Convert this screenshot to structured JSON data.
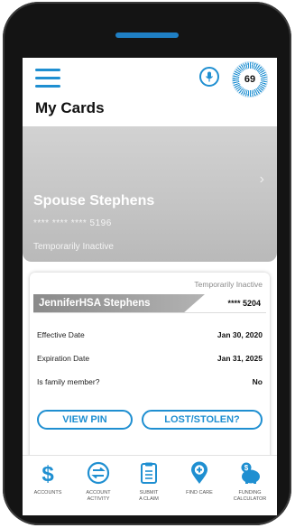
{
  "header": {
    "score": "69",
    "title": "My Cards"
  },
  "inactive_card": {
    "name": "Spouse Stephens",
    "number": "**** **** **** 5196",
    "status": "Temporarily Inactive"
  },
  "active_card": {
    "status": "Temporarily Inactive",
    "name": "JenniferHSA Stephens",
    "number": "**** 5204",
    "rows": [
      {
        "label": "Effective Date",
        "value": "Jan 30, 2020"
      },
      {
        "label": "Expiration Date",
        "value": "Jan 31, 2025"
      },
      {
        "label": "Is family member?",
        "value": "No"
      }
    ],
    "view_pin_label": "VIEW PIN",
    "lost_stolen_label": "LOST/STOLEN?"
  },
  "bottom_nav": [
    {
      "label": "ACCOUNTS",
      "icon": "dollar-icon"
    },
    {
      "label": "ACCOUNT\nACTIVITY",
      "icon": "transfer-arrows-icon"
    },
    {
      "label": "SUBMIT\nA CLAIM",
      "icon": "clipboard-icon"
    },
    {
      "label": "FIND CARE",
      "icon": "location-plus-icon"
    },
    {
      "label": "FUNDING\nCALCULATOR",
      "icon": "piggy-bank-icon"
    }
  ],
  "colors": {
    "accent": "#1f8fd1",
    "phone_body": "#141414",
    "card_gray": "#c4c4c4"
  }
}
